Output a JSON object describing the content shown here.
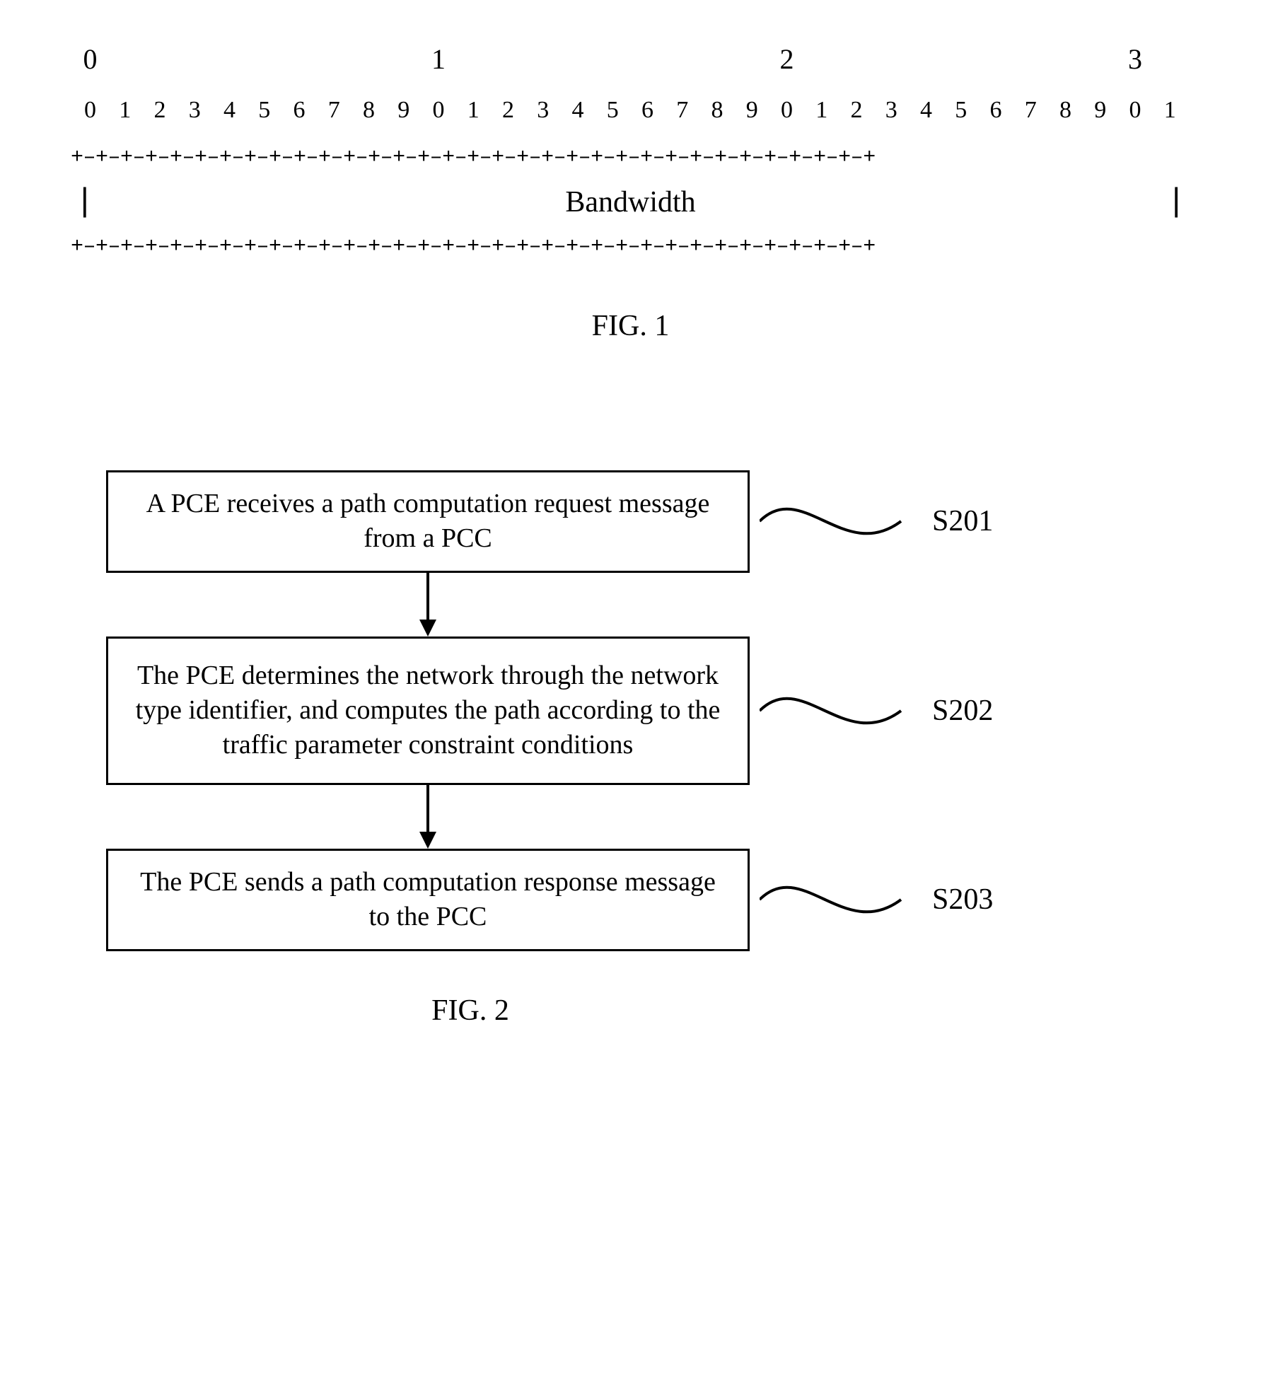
{
  "fig1": {
    "tens_row": [
      "0",
      "",
      "",
      "",
      "",
      "",
      "",
      "",
      "",
      "",
      "1",
      "",
      "",
      "",
      "",
      "",
      "",
      "",
      "",
      "",
      "2",
      "",
      "",
      "",
      "",
      "",
      "",
      "",
      "",
      "",
      "3",
      ""
    ],
    "units_row": [
      "0",
      "1",
      "2",
      "3",
      "4",
      "5",
      "6",
      "7",
      "8",
      "9",
      "0",
      "1",
      "2",
      "3",
      "4",
      "5",
      "6",
      "7",
      "8",
      "9",
      "0",
      "1",
      "2",
      "3",
      "4",
      "5",
      "6",
      "7",
      "8",
      "9",
      "0",
      "1"
    ],
    "field_label": "Bandwidth",
    "caption": "FIG. 1",
    "bit_count": 32
  },
  "fig2": {
    "steps": [
      {
        "id": "S201",
        "text": "A PCE receives a path computation request message from a PCC"
      },
      {
        "id": "S202",
        "text": "The PCE determines the network through the network type identifier, and computes the path according to the traffic parameter constraint conditions"
      },
      {
        "id": "S203",
        "text": "The PCE sends a path computation response message to the PCC"
      }
    ],
    "caption": "FIG. 2"
  }
}
